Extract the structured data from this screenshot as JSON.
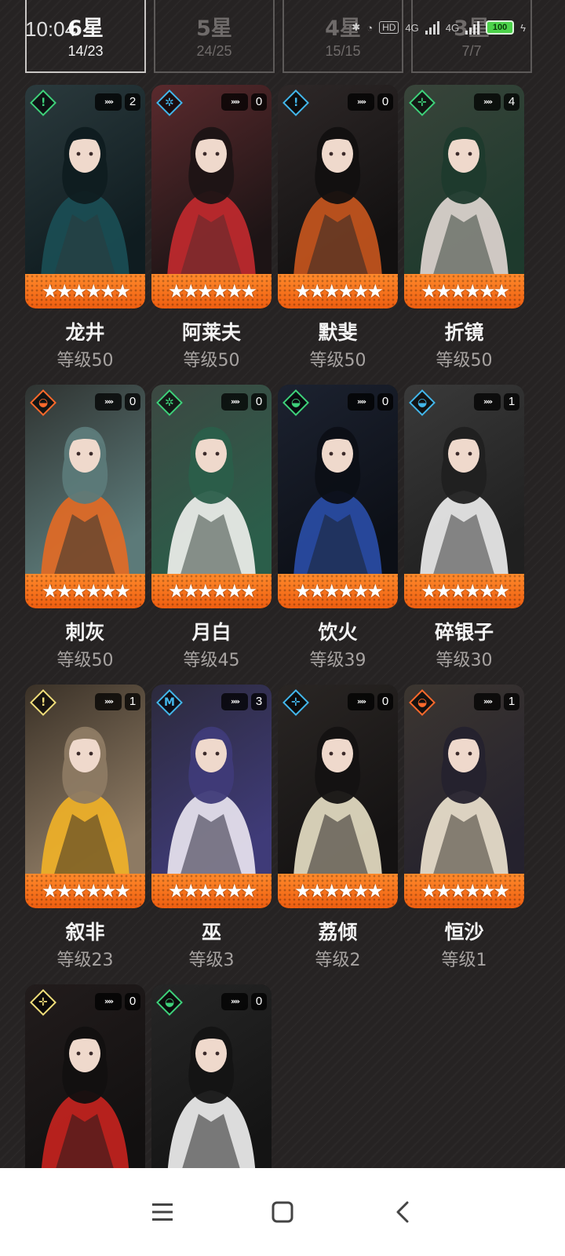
{
  "status_bar": {
    "time": "10:04",
    "hd_label": "HD",
    "net1": "4G",
    "net2": "4G",
    "battery": "100"
  },
  "tabs": [
    {
      "label": "6星",
      "count": "14/23",
      "active": true
    },
    {
      "label": "5星",
      "count": "24/25",
      "active": false
    },
    {
      "label": "4星",
      "count": "15/15",
      "active": false
    },
    {
      "label": "3星",
      "count": "7/7",
      "active": false
    }
  ],
  "characters": [
    {
      "name": "龙井",
      "level": "等级50",
      "badge": "2",
      "stars": "★★★★★★",
      "element_color": "#3ed07a",
      "element_icon": "person-icon",
      "palette": [
        "#2b3a3d",
        "#1b4f55",
        "#0f1c20"
      ]
    },
    {
      "name": "阿莱夫",
      "level": "等级50",
      "badge": "0",
      "stars": "★★★★★★",
      "element_color": "#43b6ea",
      "element_icon": "snowflake-icon",
      "palette": [
        "#5a2a2d",
        "#c42a2f",
        "#1d1415"
      ]
    },
    {
      "name": "默斐",
      "level": "等级50",
      "badge": "0",
      "stars": "★★★★★★",
      "element_color": "#43b6ea",
      "element_icon": "person-icon",
      "palette": [
        "#2e2828",
        "#c9561e",
        "#121010"
      ]
    },
    {
      "name": "折镜",
      "level": "等级50",
      "badge": "4",
      "stars": "★★★★★★",
      "element_color": "#3ed07a",
      "element_icon": "cross-icon",
      "palette": [
        "#39443a",
        "#e2d8d4",
        "#1e3a2d"
      ]
    },
    {
      "name": "刺灰",
      "level": "等级50",
      "badge": "0",
      "stars": "★★★★★★",
      "element_color": "#ff6a2c",
      "element_icon": "eye-icon",
      "palette": [
        "#2f3331",
        "#e46a24",
        "#5c7a79"
      ]
    },
    {
      "name": "月白",
      "level": "等级45",
      "badge": "0",
      "stars": "★★★★★★",
      "element_color": "#3ed07a",
      "element_icon": "snowflake-icon",
      "palette": [
        "#3c4842",
        "#f2f2ee",
        "#2b5e4a"
      ]
    },
    {
      "name": "饮火",
      "level": "等级39",
      "badge": "0",
      "stars": "★★★★★★",
      "element_color": "#3ed07a",
      "element_icon": "eye-icon",
      "palette": [
        "#1c2230",
        "#2a4ea8",
        "#0c0f16"
      ]
    },
    {
      "name": "碎银子",
      "level": "等级30",
      "badge": "1",
      "stars": "★★★★★★",
      "element_color": "#43b6ea",
      "element_icon": "eye-icon",
      "palette": [
        "#3a3a3a",
        "#efefef",
        "#202020"
      ]
    },
    {
      "name": "叙非",
      "level": "等级23",
      "badge": "1",
      "stars": "★★★★★★",
      "element_color": "#f0dd7a",
      "element_icon": "person-icon",
      "palette": [
        "#3a3127",
        "#f2b227",
        "#8d7a63"
      ]
    },
    {
      "name": "巫",
      "level": "等级3",
      "badge": "3",
      "stars": "★★★★★★",
      "element_color": "#43b6ea",
      "element_icon": "rune-icon",
      "palette": [
        "#2c2a3c",
        "#ece8f2",
        "#3f3b78"
      ]
    },
    {
      "name": "荔倾",
      "level": "等级2",
      "badge": "0",
      "stars": "★★★★★★",
      "element_color": "#43b6ea",
      "element_icon": "cross-icon",
      "palette": [
        "#2a2624",
        "#e9e1c6",
        "#141212"
      ]
    },
    {
      "name": "恒沙",
      "level": "等级1",
      "badge": "1",
      "stars": "★★★★★★",
      "element_color": "#ff6a2c",
      "element_icon": "eye-icon",
      "palette": [
        "#3c3630",
        "#efe6d2",
        "#25222e"
      ]
    },
    {
      "name": "",
      "level": "",
      "badge": "0",
      "stars": "",
      "element_color": "#f0dd7a",
      "element_icon": "cross-icon",
      "palette": [
        "#221c1c",
        "#c8231f",
        "#121010"
      ]
    },
    {
      "name": "",
      "level": "",
      "badge": "0",
      "stars": "",
      "element_color": "#3ed07a",
      "element_icon": "eye-icon",
      "palette": [
        "#262626",
        "#f2f2f2",
        "#141414"
      ]
    }
  ],
  "navbar": {
    "icons": [
      "menu-icon",
      "home-icon",
      "back-icon"
    ]
  }
}
